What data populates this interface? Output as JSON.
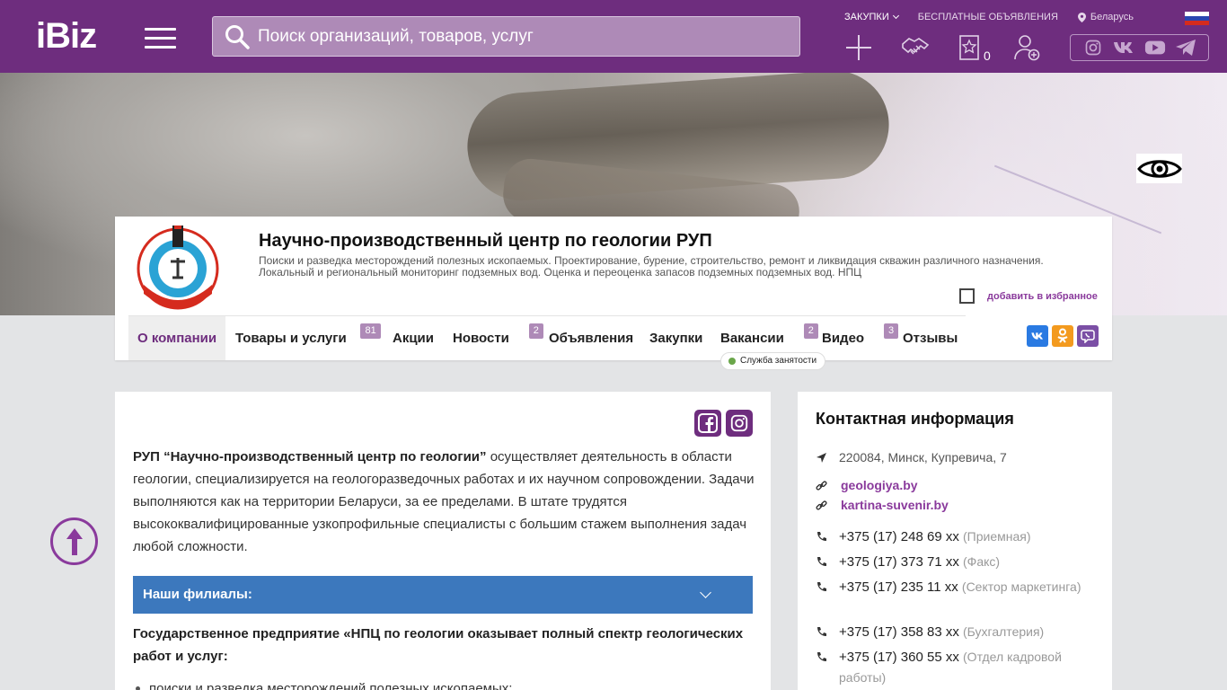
{
  "header": {
    "logo": "iBiz",
    "search_placeholder": "Поиск организаций, товаров, услуг",
    "links": [
      "ЗАКУПКИ",
      "БЕСПЛАТНЫЕ ОБЪЯВЛЕНИЯ",
      "Беларусь"
    ],
    "favorites_count": "0",
    "icons": [
      "plus-icon",
      "handshake-icon",
      "star-bookmark-icon",
      "add-user-icon"
    ],
    "social": [
      "instagram-icon",
      "vk-icon",
      "youtube-icon",
      "telegram-icon"
    ],
    "accent": "#6e2d7e"
  },
  "company": {
    "title": "Научно-производственный центр по геологии РУП",
    "description": "Поиски и разведка месторождений полезных ископаемых. Проектирование, бурение, строительство, ремонт и ликвидация скважин различного назначения. Локальный и региональный мониторинг подземных вод. Оценка и переоценка запасов подземных подземных вод. НПЦ",
    "favorite_label": "добавить в избранное",
    "tabs": [
      {
        "label": "О компании",
        "count": ""
      },
      {
        "label": "Товары и услуги",
        "count": "81"
      },
      {
        "label": "Акции",
        "count": ""
      },
      {
        "label": "Новости",
        "count": "2"
      },
      {
        "label": "Объявления",
        "count": ""
      },
      {
        "label": "Закупки",
        "count": ""
      },
      {
        "label": "Вакансии",
        "count": "2"
      },
      {
        "label": "Видео",
        "count": "3"
      },
      {
        "label": "Отзывы",
        "count": ""
      }
    ],
    "employment_badge": "Служба занятости"
  },
  "about": {
    "intro_bold": "РУП “Научно-производственный центр по геологии”",
    "intro_rest": " осуществляет деятельность в области геологии, специализируется на геологоразведочных работах и их научном сопровождении. Задачи выполняются как на территории Беларуси, за ее пределами. В штате трудятся высококвалифицированные узкопрофильные специалисты с большим стажем выполнения задач любой сложности.",
    "filials_label": "Наши филиалы:",
    "filials_color": "#3c78bd",
    "services_heading": "Государственное предприятие «НПЦ по геологии оказывает полный спектр геологических работ и услуг:",
    "first_service": "поиски и разведка месторождений полезных ископаемых;"
  },
  "contacts": {
    "title": "Контактная информация",
    "address": "220084, Минск, Купревича, 7",
    "links": [
      "geologiya.by",
      "kartina-suvenir.by"
    ],
    "phones": [
      {
        "number": "+375 (17) 248 69 xx",
        "note": "(Приемная)"
      },
      {
        "number": "+375 (17) 373 71 xx",
        "note": "(Факс)"
      },
      {
        "number": "+375 (17) 235 11 xx",
        "note": "(Сектор маркетинга)"
      },
      {
        "number": "+375 (17) 358 83 xx",
        "note": "(Бухгалтерия)"
      },
      {
        "number": "+375 (17) 360 55 xx",
        "note": "(Отдел кадровой работы)"
      }
    ]
  }
}
